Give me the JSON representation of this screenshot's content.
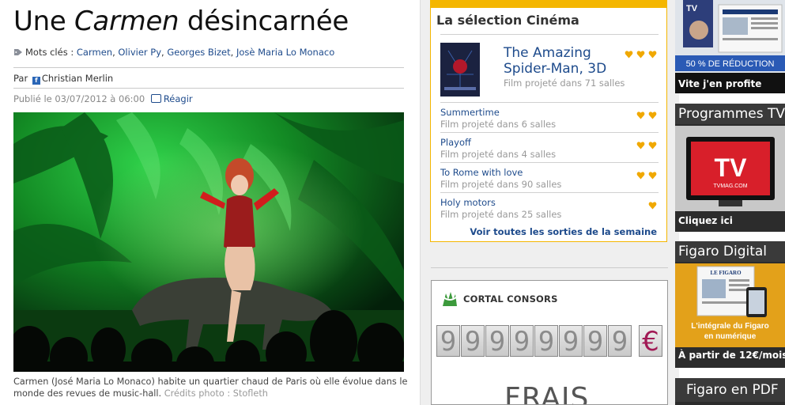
{
  "article": {
    "title_prefix": "Une ",
    "title_emphasis": "Carmen",
    "title_suffix": " désincarnée",
    "tags_label": "Mots clés : ",
    "tags": [
      "Carmen",
      "Olivier Py",
      "Georges Bizet",
      "Josè Maria Lo Monaco"
    ],
    "author_prefix": "Par ",
    "author_name": "Christian Merlin",
    "published": "Publié le 03/07/2012 à 06:00",
    "react_label": "Réagir",
    "caption": "Carmen (José Maria Lo Monaco) habite un quartier chaud de Paris où elle évolue dans le monde des revues de music-hall.",
    "photo_credit": "Crédits photo : Stofleth"
  },
  "cinema": {
    "heading": "La sélection Cinéma",
    "featured": {
      "title": "The Amazing Spider-Man, 3D",
      "subtitle": "Film projeté dans 71 salles",
      "stars": 3
    },
    "films": [
      {
        "title": "Summertime",
        "subtitle": "Film projeté dans 6 salles",
        "stars": 2
      },
      {
        "title": "Playoff",
        "subtitle": "Film projeté dans 4 salles",
        "stars": 2
      },
      {
        "title": "To Rome with love",
        "subtitle": "Film projeté dans 90 salles",
        "stars": 2
      },
      {
        "title": "Holy motors",
        "subtitle": "Film projeté dans 25 salles",
        "stars": 1
      }
    ],
    "see_all": "Voir toutes les sorties de la semaine",
    "star_color": "#f0a800"
  },
  "ad_cortal": {
    "brand": "CORTAL CONSORS",
    "digits": [
      "9",
      "9",
      "9",
      "9",
      "9",
      "9",
      "9",
      "9"
    ],
    "currency": "€",
    "headline": "FRAIS"
  },
  "right": {
    "promo1": {
      "banner": "50 % DE RÉDUCTION",
      "cta": "Vite j'en profite"
    },
    "promo2": {
      "title": "Programmes TV",
      "tv_logo": "TV",
      "tv_sub": "TVMAG.COM",
      "cta": "Cliquez ici"
    },
    "promo3": {
      "title": "Figaro Digital",
      "paper_name": "LE FIGARO",
      "line1": "L'intégrale du Figaro",
      "line2": "en numérique",
      "cta": "À partir de 12€/mois"
    },
    "promo4": {
      "title": "Figaro en PDF"
    }
  }
}
